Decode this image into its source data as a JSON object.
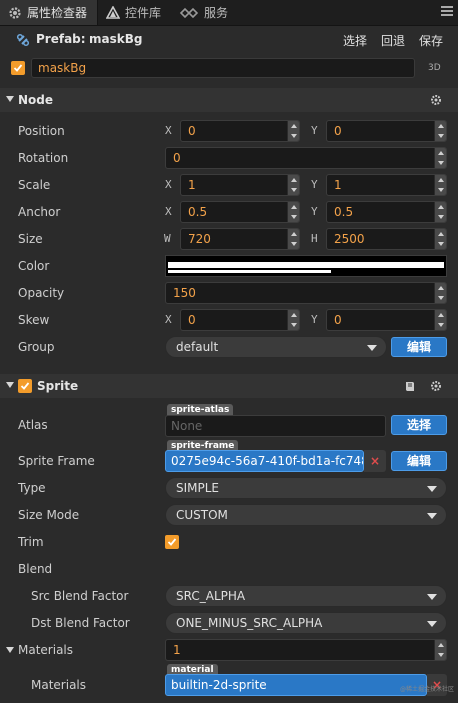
{
  "tabs": [
    {
      "label": "属性检查器",
      "icon": "gear-icon",
      "active": true
    },
    {
      "label": "控件库",
      "icon": "triangle-icon",
      "active": false
    },
    {
      "label": "服务",
      "icon": "link-icon",
      "active": false
    }
  ],
  "prefab": {
    "label": "Prefab:",
    "name": "maskBg",
    "select": "选择",
    "revert": "回退",
    "save": "保存"
  },
  "node_name": "maskBg",
  "tag_3d": "3D",
  "node_section": {
    "title": "Node",
    "position": {
      "label": "Position",
      "x_axis": "X",
      "x": "0",
      "y_axis": "Y",
      "y": "0"
    },
    "rotation": {
      "label": "Rotation",
      "value": "0"
    },
    "scale": {
      "label": "Scale",
      "x_axis": "X",
      "x": "1",
      "y_axis": "Y",
      "y": "1"
    },
    "anchor": {
      "label": "Anchor",
      "x_axis": "X",
      "x": "0.5",
      "y_axis": "Y",
      "y": "0.5"
    },
    "size": {
      "label": "Size",
      "w_axis": "W",
      "w": "720",
      "h_axis": "H",
      "h": "2500"
    },
    "color": {
      "label": "Color",
      "value": "#ffffff"
    },
    "opacity": {
      "label": "Opacity",
      "value": "150"
    },
    "skew": {
      "label": "Skew",
      "x_axis": "X",
      "x": "0",
      "y_axis": "Y",
      "y": "0"
    },
    "group": {
      "label": "Group",
      "value": "default",
      "edit": "编辑"
    }
  },
  "sprite_section": {
    "title": "Sprite",
    "atlas": {
      "label": "Atlas",
      "tag": "sprite-atlas",
      "value": "None",
      "select": "选择"
    },
    "sprite_frame": {
      "label": "Sprite Frame",
      "tag": "sprite-frame",
      "value": "0275e94c-56a7-410f-bd1a-fc748...",
      "clear": "×",
      "edit": "编辑"
    },
    "type": {
      "label": "Type",
      "value": "SIMPLE"
    },
    "size_mode": {
      "label": "Size Mode",
      "value": "CUSTOM"
    },
    "trim": {
      "label": "Trim",
      "checked": true
    },
    "blend": {
      "label": "Blend"
    },
    "src_blend": {
      "label": "Src Blend Factor",
      "value": "SRC_ALPHA"
    },
    "dst_blend": {
      "label": "Dst Blend Factor",
      "value": "ONE_MINUS_SRC_ALPHA"
    },
    "materials_count": {
      "label": "Materials",
      "value": "1"
    },
    "materials": {
      "label": "Materials",
      "tag": "material",
      "value": "builtin-2d-sprite",
      "clear": "×"
    }
  },
  "watermark": "@稀土掘金技术社区",
  "colors": {
    "accent_orange": "#f39c2b",
    "value_orange": "#f3a24a",
    "button_blue": "#2a78c6"
  }
}
